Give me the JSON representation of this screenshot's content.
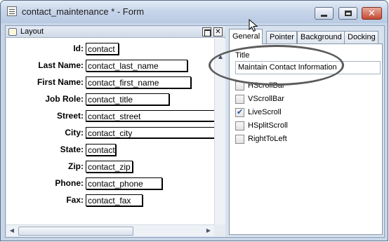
{
  "window": {
    "title": "contact_maintenance * - Form",
    "close_glyph": "✕"
  },
  "layout_panel": {
    "title": "Layout",
    "restore_glyph": "",
    "close_glyph": "✕"
  },
  "fields": [
    {
      "label": "Id:",
      "value": "contact"
    },
    {
      "label": "Last Name:",
      "value": "contact_last_name"
    },
    {
      "label": "First Name:",
      "value": "contact_first_name"
    },
    {
      "label": "Job Role:",
      "value": "contact_title"
    },
    {
      "label": "Street:",
      "value": "contact_street"
    },
    {
      "label": "City:",
      "value": "contact_city"
    },
    {
      "label": "State:",
      "value": "contact"
    },
    {
      "label": "Zip:",
      "value": "contact_zip"
    },
    {
      "label": "Phone:",
      "value": "contact_phone"
    },
    {
      "label": "Fax:",
      "value": "contact_fax"
    }
  ],
  "scroll": {
    "up_arrow": "▲",
    "left_arrow": "◀",
    "right_arrow": "▶"
  },
  "properties": {
    "tabs": [
      {
        "label": "General"
      },
      {
        "label": "Pointer"
      },
      {
        "label": "Background"
      },
      {
        "label": "Docking"
      }
    ],
    "active_tab": "General",
    "title_label": "Title",
    "title_value": "Maintain Contact Information",
    "checkboxes": [
      {
        "label": "HScrollBar",
        "checked": false
      },
      {
        "label": "VScrollBar",
        "checked": false
      },
      {
        "label": "LiveScroll",
        "checked": true
      },
      {
        "label": "HSplitScroll",
        "checked": false
      },
      {
        "label": "RightToLeft",
        "checked": false
      }
    ]
  },
  "colors": {
    "title_bar": "#c8d6ea",
    "close_button": "#c44a33",
    "highlight_ellipse": "#5c5c5c"
  },
  "icons": {
    "window": "form-icon",
    "layout": "layout-icon",
    "cursor": "mouse-pointer-icon"
  }
}
